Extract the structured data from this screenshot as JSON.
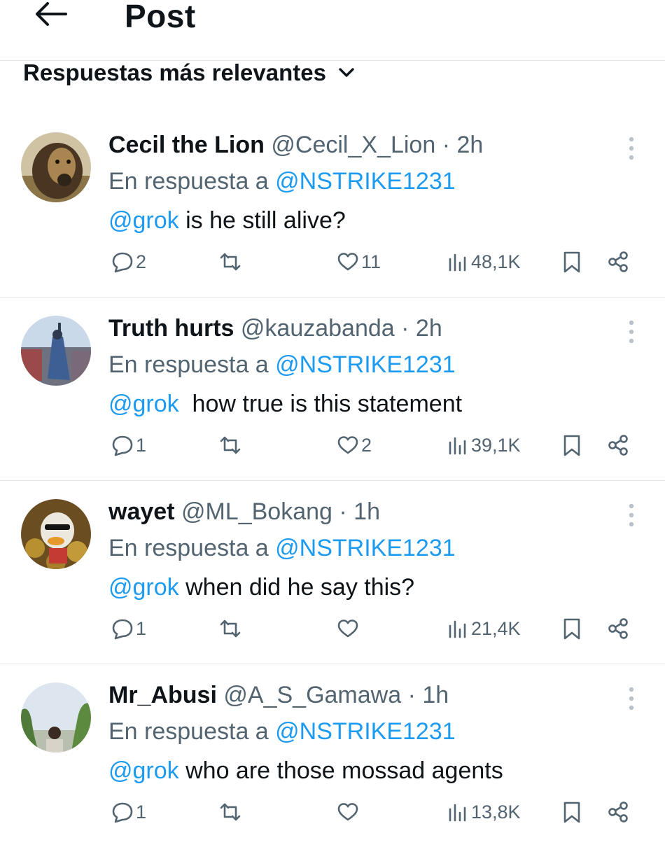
{
  "header": {
    "title": "Post",
    "back_icon": "arrow-left-icon"
  },
  "sort": {
    "label": "Respuestas más relevantes",
    "icon": "chevron-down-icon"
  },
  "colors": {
    "text": "#0f1419",
    "secondary": "#536471",
    "link": "#1d9bf0",
    "divider": "#e6e6e6"
  },
  "replies": [
    {
      "name": "Cecil the Lion",
      "handle": "@Cecil_X_Lion",
      "dot": "·",
      "time": "2h",
      "reply_prefix": "En respuesta a",
      "reply_to": "@NSTRIKE1231",
      "mention": "@grok",
      "text": " is he still alive?",
      "reply_count": "2",
      "like_count": "11",
      "views": "48,1K"
    },
    {
      "name": "Truth hurts",
      "handle": "@kauzabanda",
      "dot": "·",
      "time": "2h",
      "reply_prefix": "En respuesta a",
      "reply_to": "@NSTRIKE1231",
      "mention": "@grok",
      "text": "  how true is this statement",
      "reply_count": "1",
      "like_count": "2",
      "views": "39,1K"
    },
    {
      "name": "wayet",
      "handle": "@ML_Bokang",
      "dot": "·",
      "time": "1h",
      "reply_prefix": "En respuesta a",
      "reply_to": "@NSTRIKE1231",
      "mention": "@grok",
      "text": " when did he say this?",
      "reply_count": "1",
      "like_count": "",
      "views": "21,4K"
    },
    {
      "name": "Mr_Abusi",
      "handle": "@A_S_Gamawa",
      "dot": "·",
      "time": "1h",
      "reply_prefix": "En respuesta a",
      "reply_to": "@NSTRIKE1231",
      "mention": "@grok",
      "text": " who are those mossad agents",
      "reply_count": "1",
      "like_count": "",
      "views": "13,8K"
    }
  ]
}
